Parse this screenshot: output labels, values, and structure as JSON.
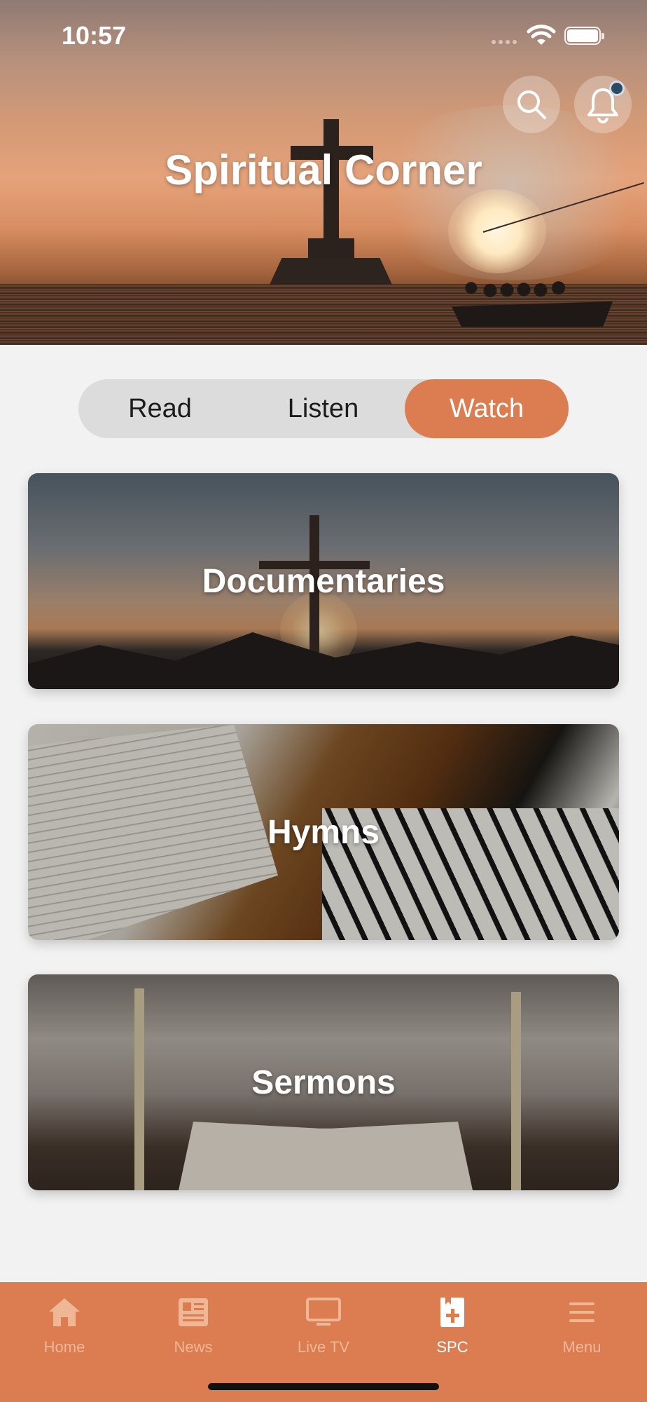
{
  "status_bar": {
    "time": "10:57"
  },
  "header": {
    "title": "Spiritual Corner",
    "search_icon": "search-icon",
    "bell_icon": "bell-icon"
  },
  "segments": [
    {
      "label": "Read",
      "selected": false
    },
    {
      "label": "Listen",
      "selected": false
    },
    {
      "label": "Watch",
      "selected": true
    }
  ],
  "cards": [
    {
      "label": "Documentaries"
    },
    {
      "label": "Hymns"
    },
    {
      "label": "Sermons"
    }
  ],
  "tabbar": {
    "items": [
      {
        "label": "Home",
        "icon": "home-icon",
        "active": false
      },
      {
        "label": "News",
        "icon": "news-icon",
        "active": false
      },
      {
        "label": "Live TV",
        "icon": "tv-icon",
        "active": false
      },
      {
        "label": "SPC",
        "icon": "spc-icon",
        "active": true
      },
      {
        "label": "Menu",
        "icon": "menu-icon",
        "active": false
      }
    ]
  },
  "colors": {
    "accent": "#db7d51",
    "segment_bg": "#dcdcdc",
    "page_bg": "#f2f2f2"
  }
}
